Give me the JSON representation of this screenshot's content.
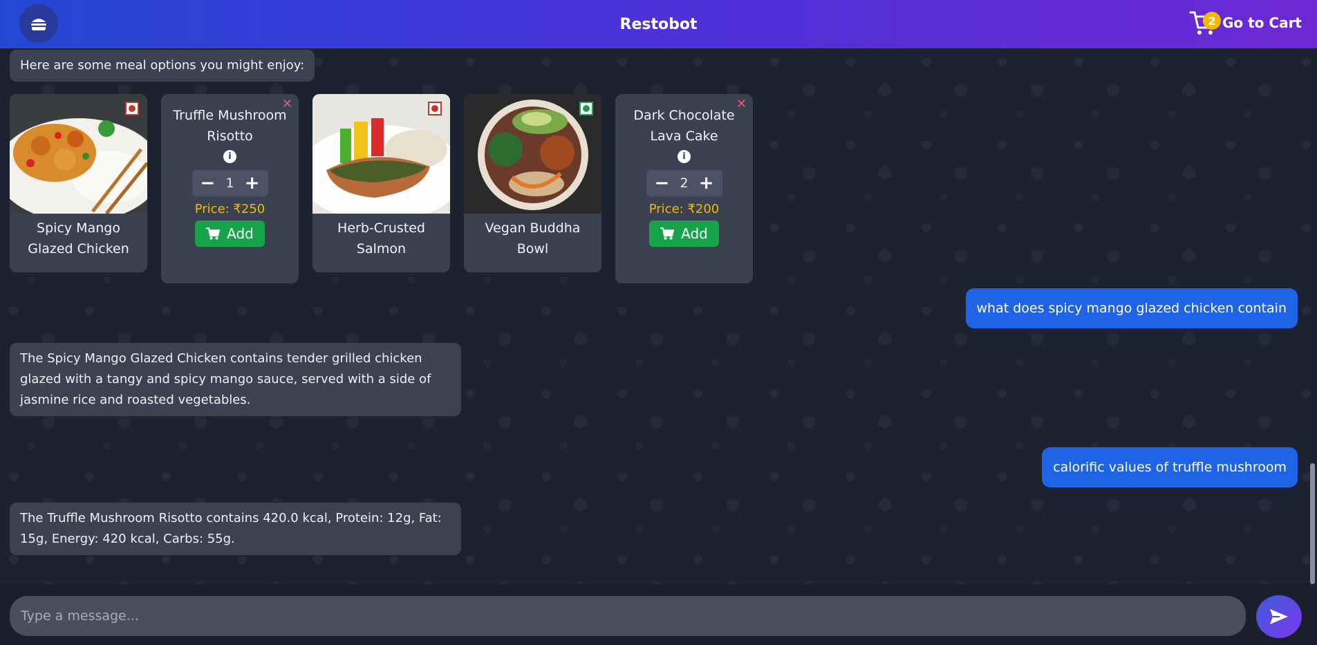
{
  "header": {
    "title": "Restobot",
    "cart_label": "Go to Cart",
    "cart_count": "2"
  },
  "chat": {
    "intro": "Here are some meal options you might enjoy:",
    "cards": [
      {
        "name": "Spicy Mango Glazed Chicken",
        "veg": false
      },
      {
        "name": "Truffle Mushroom Risotto",
        "qty": "1",
        "price": "Price: ₹250",
        "add_label": "Add"
      },
      {
        "name": "Herb-Crusted Salmon",
        "veg": false
      },
      {
        "name": "Vegan Buddha Bowl",
        "veg": true
      },
      {
        "name": "Dark Chocolate Lava Cake",
        "qty": "2",
        "price": "Price: ₹200",
        "add_label": "Add"
      }
    ],
    "user_msg_1": "what does spicy mango glazed chicken contain",
    "bot_reply_1": "The Spicy Mango Glazed Chicken contains tender grilled chicken glazed with a tangy and spicy mango sauce, served with a side of jasmine rice and roasted vegetables.",
    "user_msg_2": "calorific values of truffle mushroom",
    "bot_reply_2": "The Truffle Mushroom Risotto contains 420.0 kcal, Protein: 12g, Fat: 15g, Energy: 420 kcal, Carbs: 55g."
  },
  "composer": {
    "placeholder": "Type a message..."
  },
  "colors": {
    "header_start": "#2448d6",
    "header_end": "#6d28d3",
    "user_bubble": "#1f63e6",
    "bot_bubble": "#3b4252",
    "price": "#f5b800",
    "add_button": "#16a34a",
    "nonveg": "#c0392b",
    "veg": "#1f9d55"
  }
}
